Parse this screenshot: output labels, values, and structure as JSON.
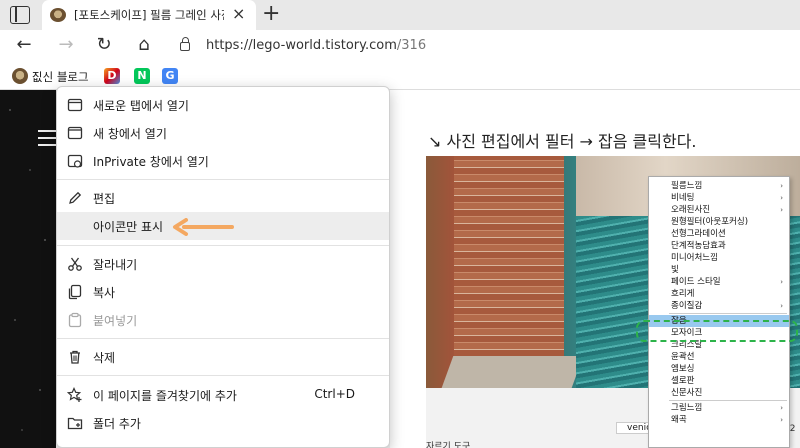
{
  "browser": {
    "tab": {
      "title": "[포토스케이프] 필름 그레인 사진"
    },
    "address": {
      "url_host": "https://lego-world.tistory.com",
      "url_path": "/316"
    },
    "favorites": [
      {
        "label": "짒신 블로그",
        "icon": "blog-favicon",
        "color": "#8a6a44"
      },
      {
        "label": "",
        "icon": "d-favicon",
        "color": "#3d7bf5",
        "letter": "D"
      },
      {
        "label": "",
        "icon": "naver-favicon",
        "color": "#03c75a",
        "letter": "N"
      },
      {
        "label": "",
        "icon": "translate-favicon",
        "color": "#4285f4",
        "letter": "G"
      }
    ]
  },
  "context_menu": {
    "items": [
      {
        "label": "새로운 탭에서 열기",
        "icon": "new-tab-icon"
      },
      {
        "label": "새 창에서 열기",
        "icon": "new-window-icon"
      },
      {
        "label": "InPrivate 창에서 열기",
        "icon": "inprivate-icon"
      },
      {
        "label": "편집",
        "icon": "pencil-icon"
      },
      {
        "label": "아이콘만 표시",
        "icon": ""
      },
      {
        "label": "잘라내기",
        "icon": "scissors-icon"
      },
      {
        "label": "복사",
        "icon": "copy-icon"
      },
      {
        "label": "붙여넣기",
        "icon": "paste-icon",
        "disabled": true
      },
      {
        "label": "삭제",
        "icon": "trash-icon"
      },
      {
        "label": "이 페이지를 즐겨찾기에 추가",
        "icon": "star-add-icon",
        "shortcut": "Ctrl+D"
      },
      {
        "label": "폴더 추가",
        "icon": "folder-add-icon"
      }
    ]
  },
  "article": {
    "instruction": "↘ 사진 편집에서 필터 → 잡음 클릭한다."
  },
  "screenshot": {
    "filter_menu": [
      {
        "label": "필름느낌",
        "submenu": true
      },
      {
        "label": "비네팅",
        "submenu": true
      },
      {
        "label": "오래된사진",
        "submenu": true
      },
      {
        "label": "원형필터(아웃포커싱)"
      },
      {
        "label": "선형그라데이션"
      },
      {
        "label": "단계적농담효과"
      },
      {
        "label": "미니어처느낌"
      },
      {
        "label": "빛"
      },
      {
        "label": "페이드 스타일",
        "submenu": true
      },
      {
        "label": "흐리게"
      },
      {
        "label": "종이질감",
        "submenu": true
      },
      {
        "label": "잡음",
        "highlight": true
      },
      {
        "label": "모자이크"
      },
      {
        "label": "크리스탈"
      },
      {
        "label": "윤곽선"
      },
      {
        "label": "엠보싱"
      },
      {
        "label": "셀로판"
      },
      {
        "label": "신문사진"
      },
      {
        "label": "그림느낌",
        "submenu": true
      },
      {
        "label": "왜곡",
        "submenu": true
      }
    ],
    "scroll_tag": "venice",
    "edge_number": "72",
    "bottom_labels": "자르기   도구"
  }
}
